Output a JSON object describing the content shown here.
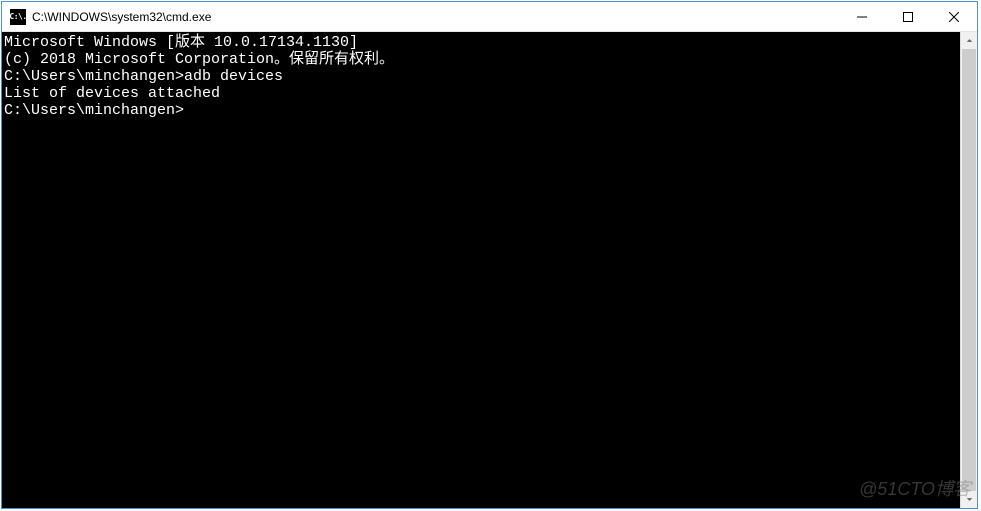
{
  "titlebar": {
    "icon_text": "C:\\.",
    "title": "C:\\WINDOWS\\system32\\cmd.exe"
  },
  "terminal": {
    "line1": "Microsoft Windows [版本 10.0.17134.1130]",
    "line2": "(c) 2018 Microsoft Corporation。保留所有权利。",
    "blank1": "",
    "prompt1": "C:\\Users\\minchangen>",
    "command1": "adb devices",
    "output1": "List of devices attached",
    "blank2": "",
    "blank3": "",
    "prompt2": "C:\\Users\\minchangen>",
    "command2": ""
  },
  "watermark": "@51CTO博客"
}
